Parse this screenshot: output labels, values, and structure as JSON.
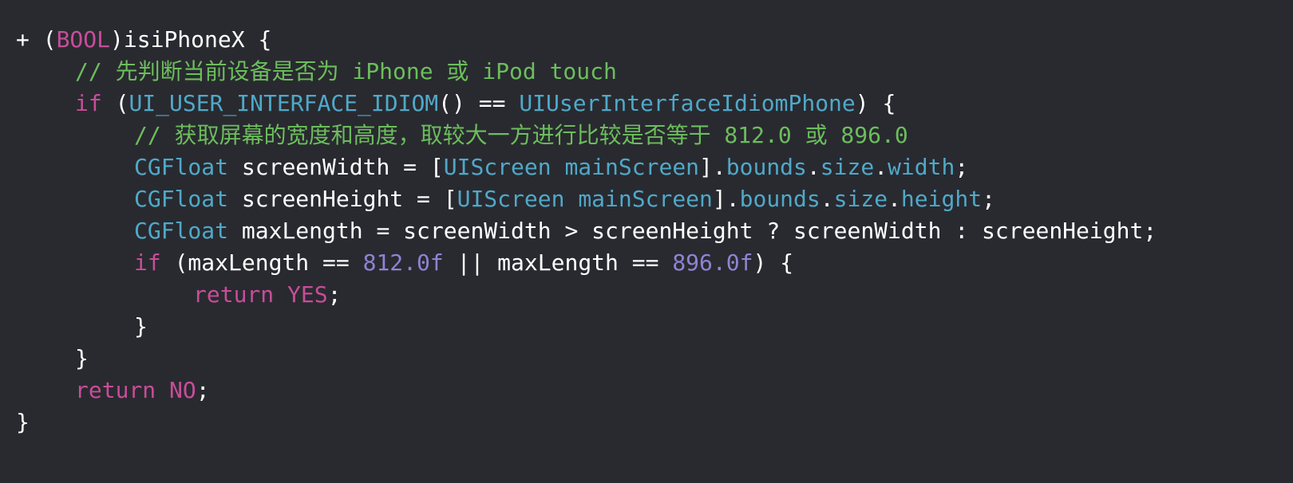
{
  "colors": {
    "background": "#292a30",
    "plain_text": "#ffffff",
    "keyword": "#c84d99",
    "type_or_api": "#4fa9c9",
    "comment": "#6cbe5c",
    "number": "#8f83d4"
  },
  "code": {
    "lines": [
      {
        "indent": 0,
        "tokens": [
          {
            "t": "pl",
            "v": "+ ("
          },
          {
            "t": "kw",
            "v": "BOOL"
          },
          {
            "t": "pl",
            "v": ")isiPhoneX {"
          }
        ]
      },
      {
        "indent": 1,
        "tokens": [
          {
            "t": "cm",
            "v": "// 先判断当前设备是否为 iPhone 或 iPod touch"
          }
        ]
      },
      {
        "indent": 1,
        "tokens": [
          {
            "t": "kw",
            "v": "if"
          },
          {
            "t": "pl",
            "v": " ("
          },
          {
            "t": "ty",
            "v": "UI_USER_INTERFACE_IDIOM"
          },
          {
            "t": "pl",
            "v": "() == "
          },
          {
            "t": "ty",
            "v": "UIUserInterfaceIdiomPhone"
          },
          {
            "t": "pl",
            "v": ") {"
          }
        ]
      },
      {
        "indent": 2,
        "tokens": [
          {
            "t": "cm",
            "v": "// 获取屏幕的宽度和高度，取较大一方进行比较是否等于 812.0 或 896.0"
          }
        ]
      },
      {
        "indent": 2,
        "tokens": [
          {
            "t": "ty",
            "v": "CGFloat"
          },
          {
            "t": "pl",
            "v": " screenWidth = ["
          },
          {
            "t": "ty",
            "v": "UIScreen"
          },
          {
            "t": "pl",
            "v": " "
          },
          {
            "t": "ty",
            "v": "mainScreen"
          },
          {
            "t": "pl",
            "v": "]."
          },
          {
            "t": "ty",
            "v": "bounds"
          },
          {
            "t": "pl",
            "v": "."
          },
          {
            "t": "ty",
            "v": "size"
          },
          {
            "t": "pl",
            "v": "."
          },
          {
            "t": "ty",
            "v": "width"
          },
          {
            "t": "pl",
            "v": ";"
          }
        ]
      },
      {
        "indent": 2,
        "tokens": [
          {
            "t": "ty",
            "v": "CGFloat"
          },
          {
            "t": "pl",
            "v": " screenHeight = ["
          },
          {
            "t": "ty",
            "v": "UIScreen"
          },
          {
            "t": "pl",
            "v": " "
          },
          {
            "t": "ty",
            "v": "mainScreen"
          },
          {
            "t": "pl",
            "v": "]."
          },
          {
            "t": "ty",
            "v": "bounds"
          },
          {
            "t": "pl",
            "v": "."
          },
          {
            "t": "ty",
            "v": "size"
          },
          {
            "t": "pl",
            "v": "."
          },
          {
            "t": "ty",
            "v": "height"
          },
          {
            "t": "pl",
            "v": ";"
          }
        ]
      },
      {
        "indent": 2,
        "tokens": [
          {
            "t": "ty",
            "v": "CGFloat"
          },
          {
            "t": "pl",
            "v": " maxLength = screenWidth > screenHeight ? screenWidth : screenHeight;"
          }
        ]
      },
      {
        "indent": 2,
        "tokens": [
          {
            "t": "kw",
            "v": "if"
          },
          {
            "t": "pl",
            "v": " (maxLength == "
          },
          {
            "t": "num",
            "v": "812.0f"
          },
          {
            "t": "pl",
            "v": " || maxLength == "
          },
          {
            "t": "num",
            "v": "896.0f"
          },
          {
            "t": "pl",
            "v": ") {"
          }
        ]
      },
      {
        "indent": 3,
        "tokens": [
          {
            "t": "kw",
            "v": "return"
          },
          {
            "t": "pl",
            "v": " "
          },
          {
            "t": "kw",
            "v": "YES"
          },
          {
            "t": "pl",
            "v": ";"
          }
        ]
      },
      {
        "indent": 2,
        "tokens": [
          {
            "t": "pl",
            "v": "}"
          }
        ]
      },
      {
        "indent": 1,
        "tokens": [
          {
            "t": "pl",
            "v": "}"
          }
        ]
      },
      {
        "indent": 1,
        "tokens": [
          {
            "t": "kw",
            "v": "return"
          },
          {
            "t": "pl",
            "v": " "
          },
          {
            "t": "kw",
            "v": "NO"
          },
          {
            "t": "pl",
            "v": ";"
          }
        ]
      },
      {
        "indent": 0,
        "tokens": [
          {
            "t": "pl",
            "v": "}"
          }
        ]
      }
    ]
  }
}
